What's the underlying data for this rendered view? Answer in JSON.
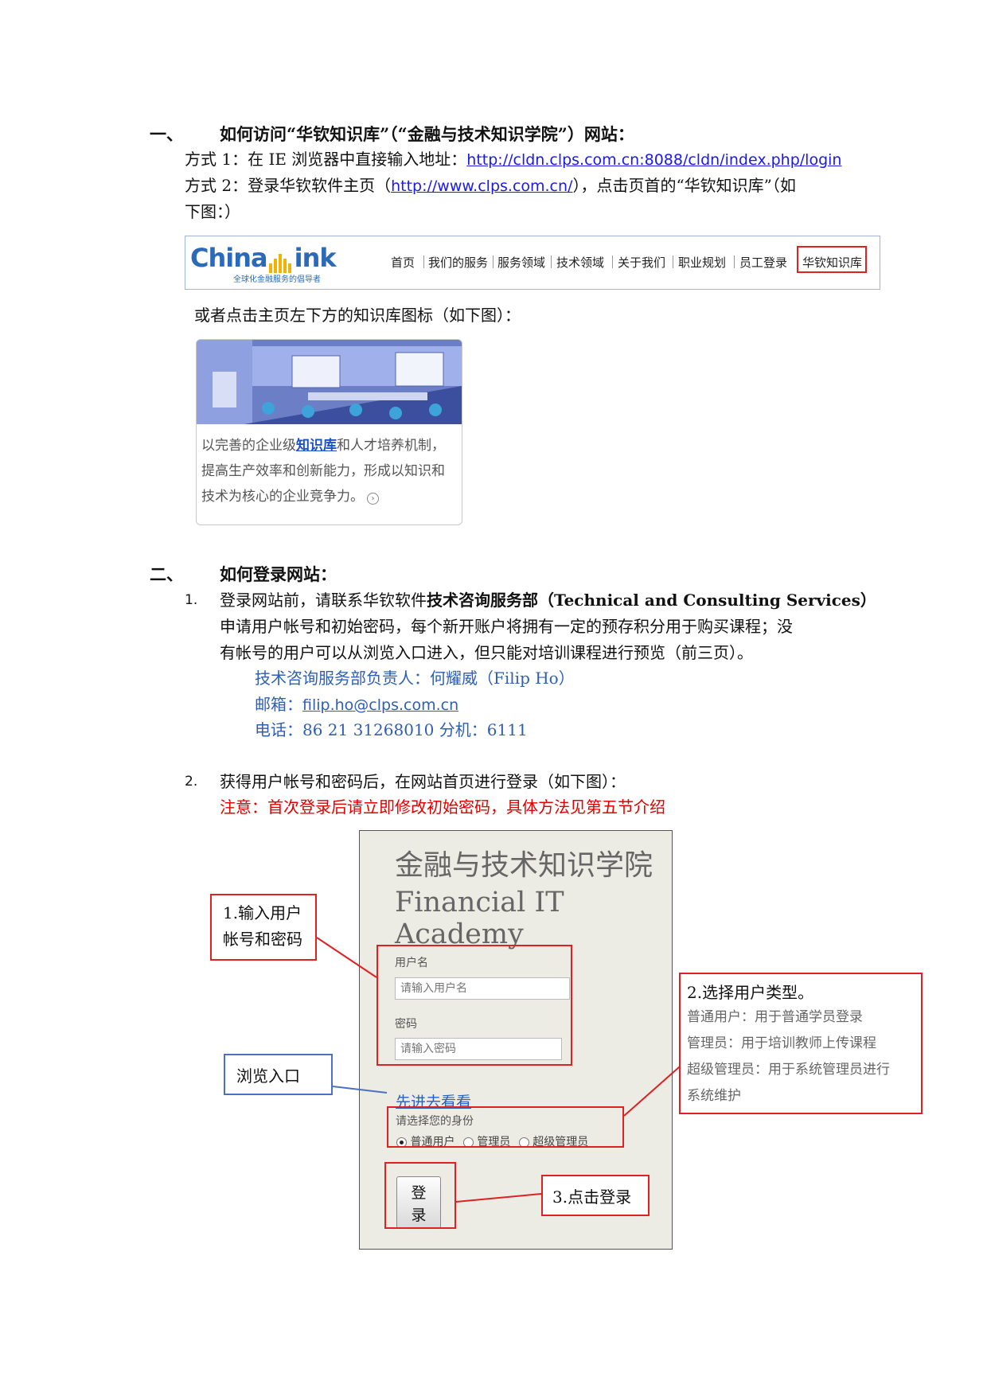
{
  "section1": {
    "number": "一、",
    "title": "如何访问“华钦知识库”（“金融与技术知识学院”）网站：",
    "method1_prefix": "方式 1：在 IE 浏览器中直接输入地址：",
    "method1_url": "http://cldn.clps.com.cn:8088/cldn/index.php/login",
    "method2_prefix": "方式 2：登录华钦软件主页（",
    "method2_url": "http://www.clps.com.cn/",
    "method2_suffix": "），点击页首的“华钦知识库”（如",
    "method2_line2": "下图：）",
    "or_text": "或者点击主页左下方的知识库图标（如下图）："
  },
  "navbar": {
    "logo": "ChinaLink",
    "logo_text_a": "China",
    "logo_text_b": "ink",
    "tagline": "全球化金融服务的倡导者",
    "items": [
      "首页",
      "我们的服务",
      "服务领域",
      "技术领域",
      "关于我们",
      "职业规划",
      "员工登录",
      "华钦知识库"
    ]
  },
  "card": {
    "line1_pre": "以完善的企业级",
    "line1_link": "知识库",
    "line1_post": "和人才培养机制，",
    "line2": "提高生产效率和创新能力，形成以知识和",
    "line3": "技术为核心的企业竞争力。"
  },
  "section2": {
    "number": "二、",
    "title": "如何登录网站：",
    "item1_num": "1.",
    "item1_line1_a": "登录网站前，请联系华钦软件",
    "item1_line1_bold": "技术咨询服务部（Technical and Consulting Services）",
    "item1_line2": "申请用户帐号和初始密码，每个新开账户将拥有一定的预存积分用于购买课程；没",
    "item1_line3": "有帐号的用户可以从浏览入口进入，但只能对培训课程进行预览（前三页）。",
    "contact_person": "技术咨询服务部负责人：何耀威（Filip Ho）",
    "email_label": "邮箱：",
    "email": "filip.ho@clps.com.cn",
    "phone": "电话：86 21 31268010  分机：6111",
    "item2_num": "2.",
    "item2_text": "获得用户帐号和密码后，在网站首页进行登录（如下图）：",
    "notice": "注意：首次登录后请立即修改初始密码，具体方法见第五节介绍"
  },
  "login": {
    "title_cn": "金融与技术知识学院",
    "title_en": "Financial IT Academy",
    "username_label": "用户名",
    "username_placeholder": "请输入用户名",
    "password_label": "密码",
    "password_placeholder": "请输入密码",
    "browse_link": "先进去看看",
    "role_label": "请选择您的身份",
    "roles": [
      "普通用户",
      "管理员",
      "超级管理员"
    ],
    "login_btn_1": "登",
    "login_btn_2": "录"
  },
  "callouts": {
    "c1_line1": "1.输入用户",
    "c1_line2": "帐号和密码",
    "c2_title": "2.选择用户类型。",
    "c2_line1": "普通用户：用于普通学员登录",
    "c2_line2": "管理员：用于培训教师上传课程",
    "c2_line3": "超级管理员：用于系统管理员进行",
    "c2_line4": "系统维护",
    "c3": "3.点击登录",
    "browse": "浏览入口"
  },
  "colors": {
    "link": "#1a1ae6",
    "blue_text": "#2e5fb3",
    "red": "#e00000",
    "callout_red": "#d22222",
    "callout_blue": "#4a72c0"
  }
}
